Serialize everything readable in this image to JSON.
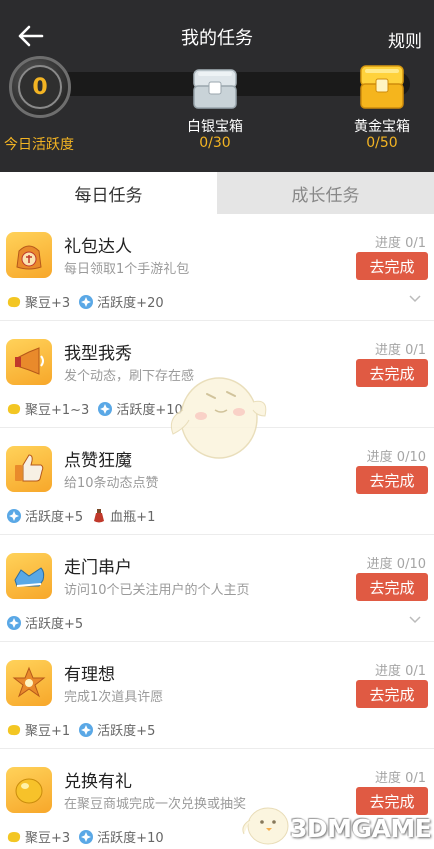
{
  "header": {
    "title": "我的任务",
    "rules_label": "规则",
    "activity_value": "0",
    "activity_label": "今日活跃度",
    "chests": [
      {
        "name": "白银宝箱",
        "progress": "0/30"
      },
      {
        "name": "黄金宝箱",
        "progress": "0/50"
      }
    ]
  },
  "tabs": [
    {
      "label": "每日任务",
      "active": true
    },
    {
      "label": "成长任务",
      "active": false
    }
  ],
  "tasks": [
    {
      "title": "礼包达人",
      "desc": "每日领取1个手游礼包",
      "progress": "进度 0/1",
      "button": "去完成",
      "rewards": [
        {
          "icon": "bean-icon",
          "text": "聚豆+3"
        },
        {
          "icon": "activity-icon",
          "text": "活跃度+20"
        }
      ],
      "expandable": true
    },
    {
      "title": "我型我秀",
      "desc": "发个动态，刷下存在感",
      "progress": "进度 0/1",
      "button": "去完成",
      "rewards": [
        {
          "icon": "bean-icon",
          "text": "聚豆+1~3"
        },
        {
          "icon": "activity-icon",
          "text": "活跃度+10"
        }
      ],
      "expandable": false
    },
    {
      "title": "点赞狂魔",
      "desc": "给10条动态点赞",
      "progress": "进度 0/10",
      "button": "去完成",
      "rewards": [
        {
          "icon": "activity-icon",
          "text": "活跃度+5"
        },
        {
          "icon": "potion-icon",
          "text": "血瓶+1"
        }
      ],
      "expandable": false
    },
    {
      "title": "走门串户",
      "desc": "访问10个已关注用户的个人主页",
      "progress": "进度 0/10",
      "button": "去完成",
      "rewards": [
        {
          "icon": "activity-icon",
          "text": "活跃度+5"
        }
      ],
      "expandable": true
    },
    {
      "title": "有理想",
      "desc": "完成1次道具许愿",
      "progress": "进度 0/1",
      "button": "去完成",
      "rewards": [
        {
          "icon": "bean-icon",
          "text": "聚豆+1"
        },
        {
          "icon": "activity-icon",
          "text": "活跃度+5"
        }
      ],
      "expandable": false
    },
    {
      "title": "兑换有礼",
      "desc": "在聚豆商城完成一次兑换或抽奖",
      "progress": "进度 0/1",
      "button": "去完成",
      "rewards": [
        {
          "icon": "bean-icon",
          "text": "聚豆+3"
        },
        {
          "icon": "activity-icon",
          "text": "活跃度+10"
        }
      ],
      "expandable": false
    }
  ],
  "watermark": "3DMGAME",
  "colors": {
    "accent_button": "#e05a43",
    "gold_text": "#f3b423",
    "header_bg": "#2c2c2e"
  }
}
